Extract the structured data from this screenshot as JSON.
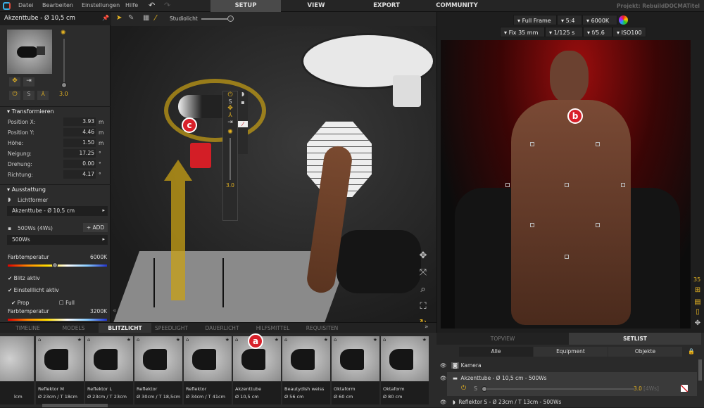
{
  "menu": {
    "items": [
      "Datei",
      "Bearbeiten",
      "Einstellungen",
      "Hilfe"
    ],
    "tabs": [
      "SETUP",
      "VIEW",
      "EXPORT",
      "COMMUNITY"
    ],
    "project": "Projekt: RebuildDOCMATitel"
  },
  "toolbar": {
    "studiolight_label": "Studiolicht",
    "studiolight_value": 0.85
  },
  "left": {
    "title": "Akzenttube - Ø 10,5 cm",
    "power_value": "3.0",
    "s_label": "S",
    "transform": {
      "label": "Transformieren",
      "rows": [
        {
          "label": "Position X:",
          "value": "3.93",
          "unit": "m"
        },
        {
          "label": "Position Y:",
          "value": "4.46",
          "unit": "m"
        },
        {
          "label": "Höhe:",
          "value": "1.50",
          "unit": "m"
        },
        {
          "label": "Neigung:",
          "value": "17.25",
          "unit": "°"
        },
        {
          "label": "Drehung:",
          "value": "0.00",
          "unit": "°"
        },
        {
          "label": "Richtung:",
          "value": "4.17",
          "unit": "°"
        }
      ]
    },
    "equipment": {
      "label": "Ausstattung",
      "modifier_label": "Lichtformer",
      "modifier_value": "Akzenttube - Ø 10,5 cm",
      "flash_label": "500Ws (4Ws)",
      "add_label": "+ ADD",
      "flash_value": "500Ws"
    },
    "color_temp": {
      "label": "Farbtemperatur",
      "value": "6000K",
      "fraction": 0.5
    },
    "flash_active": "Blitz aktiv",
    "modeling_active": "Einstelllicht aktiv",
    "prop_label": "Prop",
    "full_label": "Full",
    "color_temp2": {
      "label": "Farbtemperatur",
      "value": "3200K",
      "fraction": 0.15
    }
  },
  "viewport": {
    "float_power": "3.0",
    "markers": {
      "a": "a",
      "b": "b",
      "c": "c"
    }
  },
  "camera": {
    "sensor": "Full Frame",
    "ratio": "5:4",
    "wb": "6000K",
    "lens": "Fix 35 mm",
    "shutter": "1/125 s",
    "aperture": "f/5.6",
    "iso": "ISO100",
    "focal_side": "35"
  },
  "bottom": {
    "tabs": [
      "TIMELINE",
      "MODELS",
      "BLITZLICHT",
      "SPEEDLIGHT",
      "DAUERLICHT",
      "HILFSMITTEL",
      "REQUISITEN"
    ],
    "partial_card": "lcm",
    "cards": [
      {
        "name": "Reflektor M",
        "size": "Ø 23cm / T 18cm"
      },
      {
        "name": "Reflektor L",
        "size": "Ø 23cm / T 23cm"
      },
      {
        "name": "Reflektor",
        "size": "Ø 30cm / T 18,5cm"
      },
      {
        "name": "Reflektor",
        "size": "Ø 34cm / T 41cm"
      },
      {
        "name": "Akzenttube",
        "size": "Ø 10,5 cm"
      },
      {
        "name": "Beautydish weiss",
        "size": "Ø 56 cm"
      },
      {
        "name": "Oktaform",
        "size": "Ø 60 cm"
      },
      {
        "name": "Oktaform",
        "size": "Ø 80 cm"
      }
    ]
  },
  "setlist": {
    "tabs": [
      "TOPVIEW",
      "SETLIST"
    ],
    "filters": [
      "Alle",
      "Equipment",
      "Objekte"
    ],
    "rows": [
      "Kamera",
      "Akzenttube - Ø 10,5 cm - 500Ws",
      "Reflektor S - Ø 23cm / T 13cm - 500Ws"
    ],
    "s_label": "S",
    "power": "3.0",
    "power_ws": "[4Ws]"
  },
  "colors": {
    "accent": "#e6b422",
    "marker": "#d8202a"
  }
}
